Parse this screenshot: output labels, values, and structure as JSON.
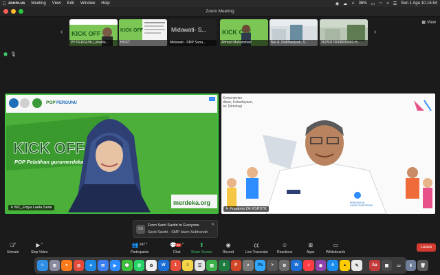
{
  "menubar": {
    "app_name": "zoom.us",
    "items": [
      "Meeting",
      "View",
      "Edit",
      "Window",
      "Help"
    ],
    "battery": "36%",
    "datetime": "Sen 1 Agu  10.15.54"
  },
  "window": {
    "title": "Zoom Meeting"
  },
  "view_button": "View",
  "strip": {
    "participants": [
      {
        "name": "PP PERGUNU_khalda..."
      },
      {
        "name": "HOST"
      },
      {
        "name": "Midawati - SMP Suna...",
        "big": "Midawati- S..."
      },
      {
        "name": "Ahmad Muhammad"
      },
      {
        "name": "Nur A. Rahmaniyah, S..."
      },
      {
        "name": "36250170068000002-H..."
      }
    ]
  },
  "tiles": {
    "left": {
      "name": "MC_Fidya Laela Sarie",
      "banner_title": "KICK OFF",
      "banner_sub": "POP Pelatihan gurumerdeka.org",
      "banner_url": "merdeka.org",
      "logo_text": "PERGUNU"
    },
    "right": {
      "name": "Praptono Dit KSPSTK",
      "header_text": "...dikan, Kebudayaan,\n...an Teknologi",
      "logo_caption": "PENDIDIKAN GURU PENGGERAK"
    }
  },
  "toast": {
    "avatar": "SS",
    "line1": "From Santi Savitri to Everyone",
    "line2": "Santi Savitri - SMP Islam Subhanah"
  },
  "controls": {
    "unmute": "Unmute",
    "stop_video": "Stop Video",
    "participants": "Participants",
    "participant_count": "247",
    "chat": "Chat",
    "chat_badge": "82",
    "share_screen": "Share Screen",
    "record": "Record",
    "live_transcript": "Live Transcript",
    "reactions": "Reactions",
    "apps": "Apps",
    "whiteboards": "Whiteboards",
    "leave": "Leave"
  },
  "colors": {
    "zoom_blue": "#2d8cff",
    "leave_red": "#d43a2f",
    "share_green": "#3ec46d",
    "banner_green": "#43a047"
  }
}
